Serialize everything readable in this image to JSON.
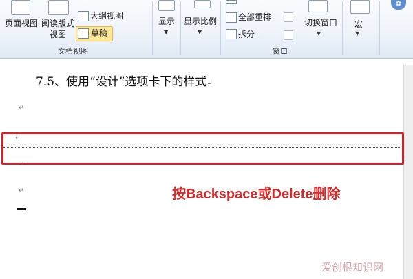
{
  "ribbon": {
    "doc_views": {
      "page_view": "页面视图",
      "reading_view_line1": "阅读版式",
      "reading_view_line2": "视图",
      "outline": "大纲视图",
      "draft": "草稿",
      "group_label": "文档视图"
    },
    "show": {
      "label": "显示"
    },
    "zoom": {
      "label": "显示比例"
    },
    "window": {
      "arrange_all": "全部重排",
      "split": "拆分",
      "switch_windows": "切换窗口",
      "group_label": "窗口"
    },
    "macros": {
      "label": "宏"
    }
  },
  "document": {
    "heading": "7.5、使用“设计”选项卡下的样式",
    "paragraph_mark": "↵"
  },
  "annotation": {
    "caption": "按Backspace或Delete删除",
    "highlight_color": "#d0222a"
  },
  "watermark": {
    "text": "爱创根知识网"
  }
}
